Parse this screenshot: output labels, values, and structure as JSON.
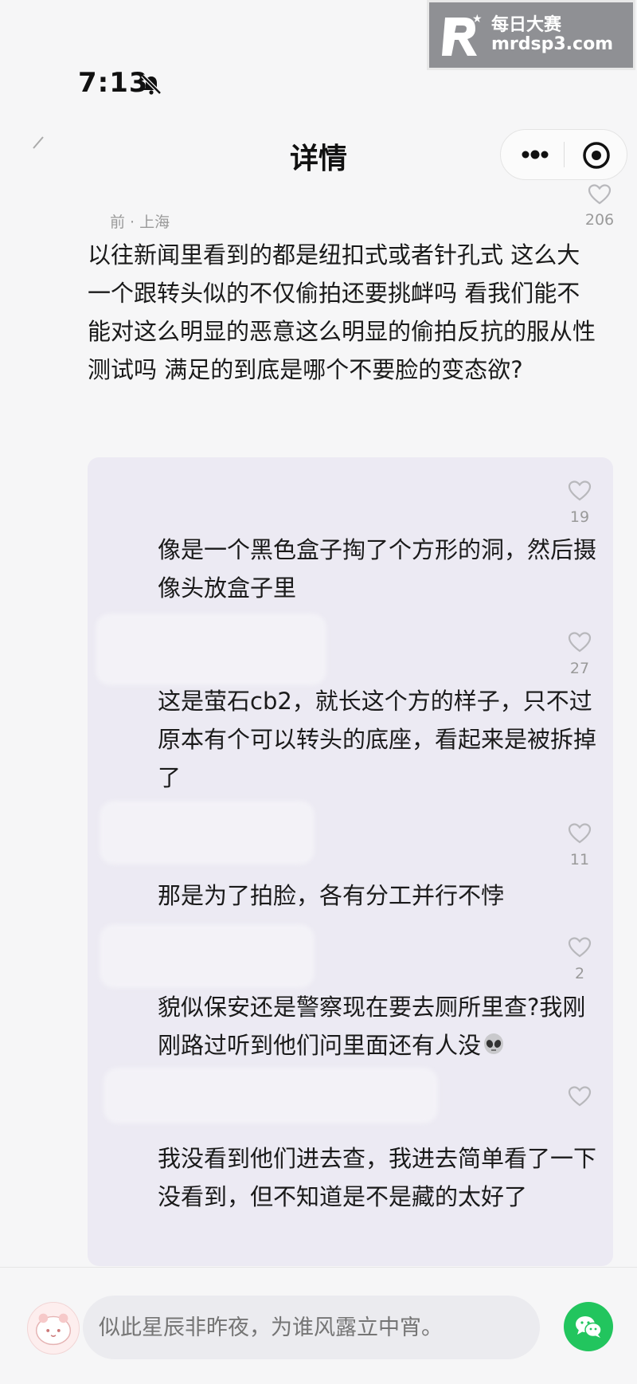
{
  "watermark": {
    "name": "每日大赛",
    "domain": "mrdsp3.com"
  },
  "status_bar": {
    "time": "7:13"
  },
  "header": {
    "title": "详情"
  },
  "post": {
    "meta": "前 · 上海",
    "like_count": "206",
    "body": "以往新闻里看到的都是纽扣式或者针孔式  这么大一个跟转头似的不仅偷拍还要挑衅吗  看我们能不能对这么明显的恶意这么明显的偷拍反抗的服从性测试吗  满足的到底是哪个不要脸的变态欲?"
  },
  "comments": [
    {
      "likes": "19",
      "text": "像是一个黑色盒子掏了个方形的洞，然后摄像头放盒子里"
    },
    {
      "likes": "27",
      "text": "这是萤石cb2，就长这个方的样子，只不过原本有个可以转头的底座，看起来是被拆掉了"
    },
    {
      "likes": "11",
      "text": "那是为了拍脸，各有分工并行不悖"
    },
    {
      "likes": "2",
      "text": "貌似保安还是警察现在要去厕所里查?我刚刚路过听到他们问里面还有人没"
    },
    {
      "likes": "",
      "text": "我没看到他们进去查，我进去简单看了一下没看到，但不知道是不是藏的太好了"
    }
  ],
  "input": {
    "placeholder": "似此星辰非昨夜，为谁风露立中宵。"
  },
  "icons": {
    "more": "more-dots-icon",
    "target": "target-circle-icon",
    "like": "heart-outline-icon",
    "emoji": "alien-emoji-icon",
    "share": "wechat-icon"
  },
  "colors": {
    "accent_green": "#22c55e",
    "panel": "#eceaf3",
    "muted": "#9a9a9a"
  }
}
